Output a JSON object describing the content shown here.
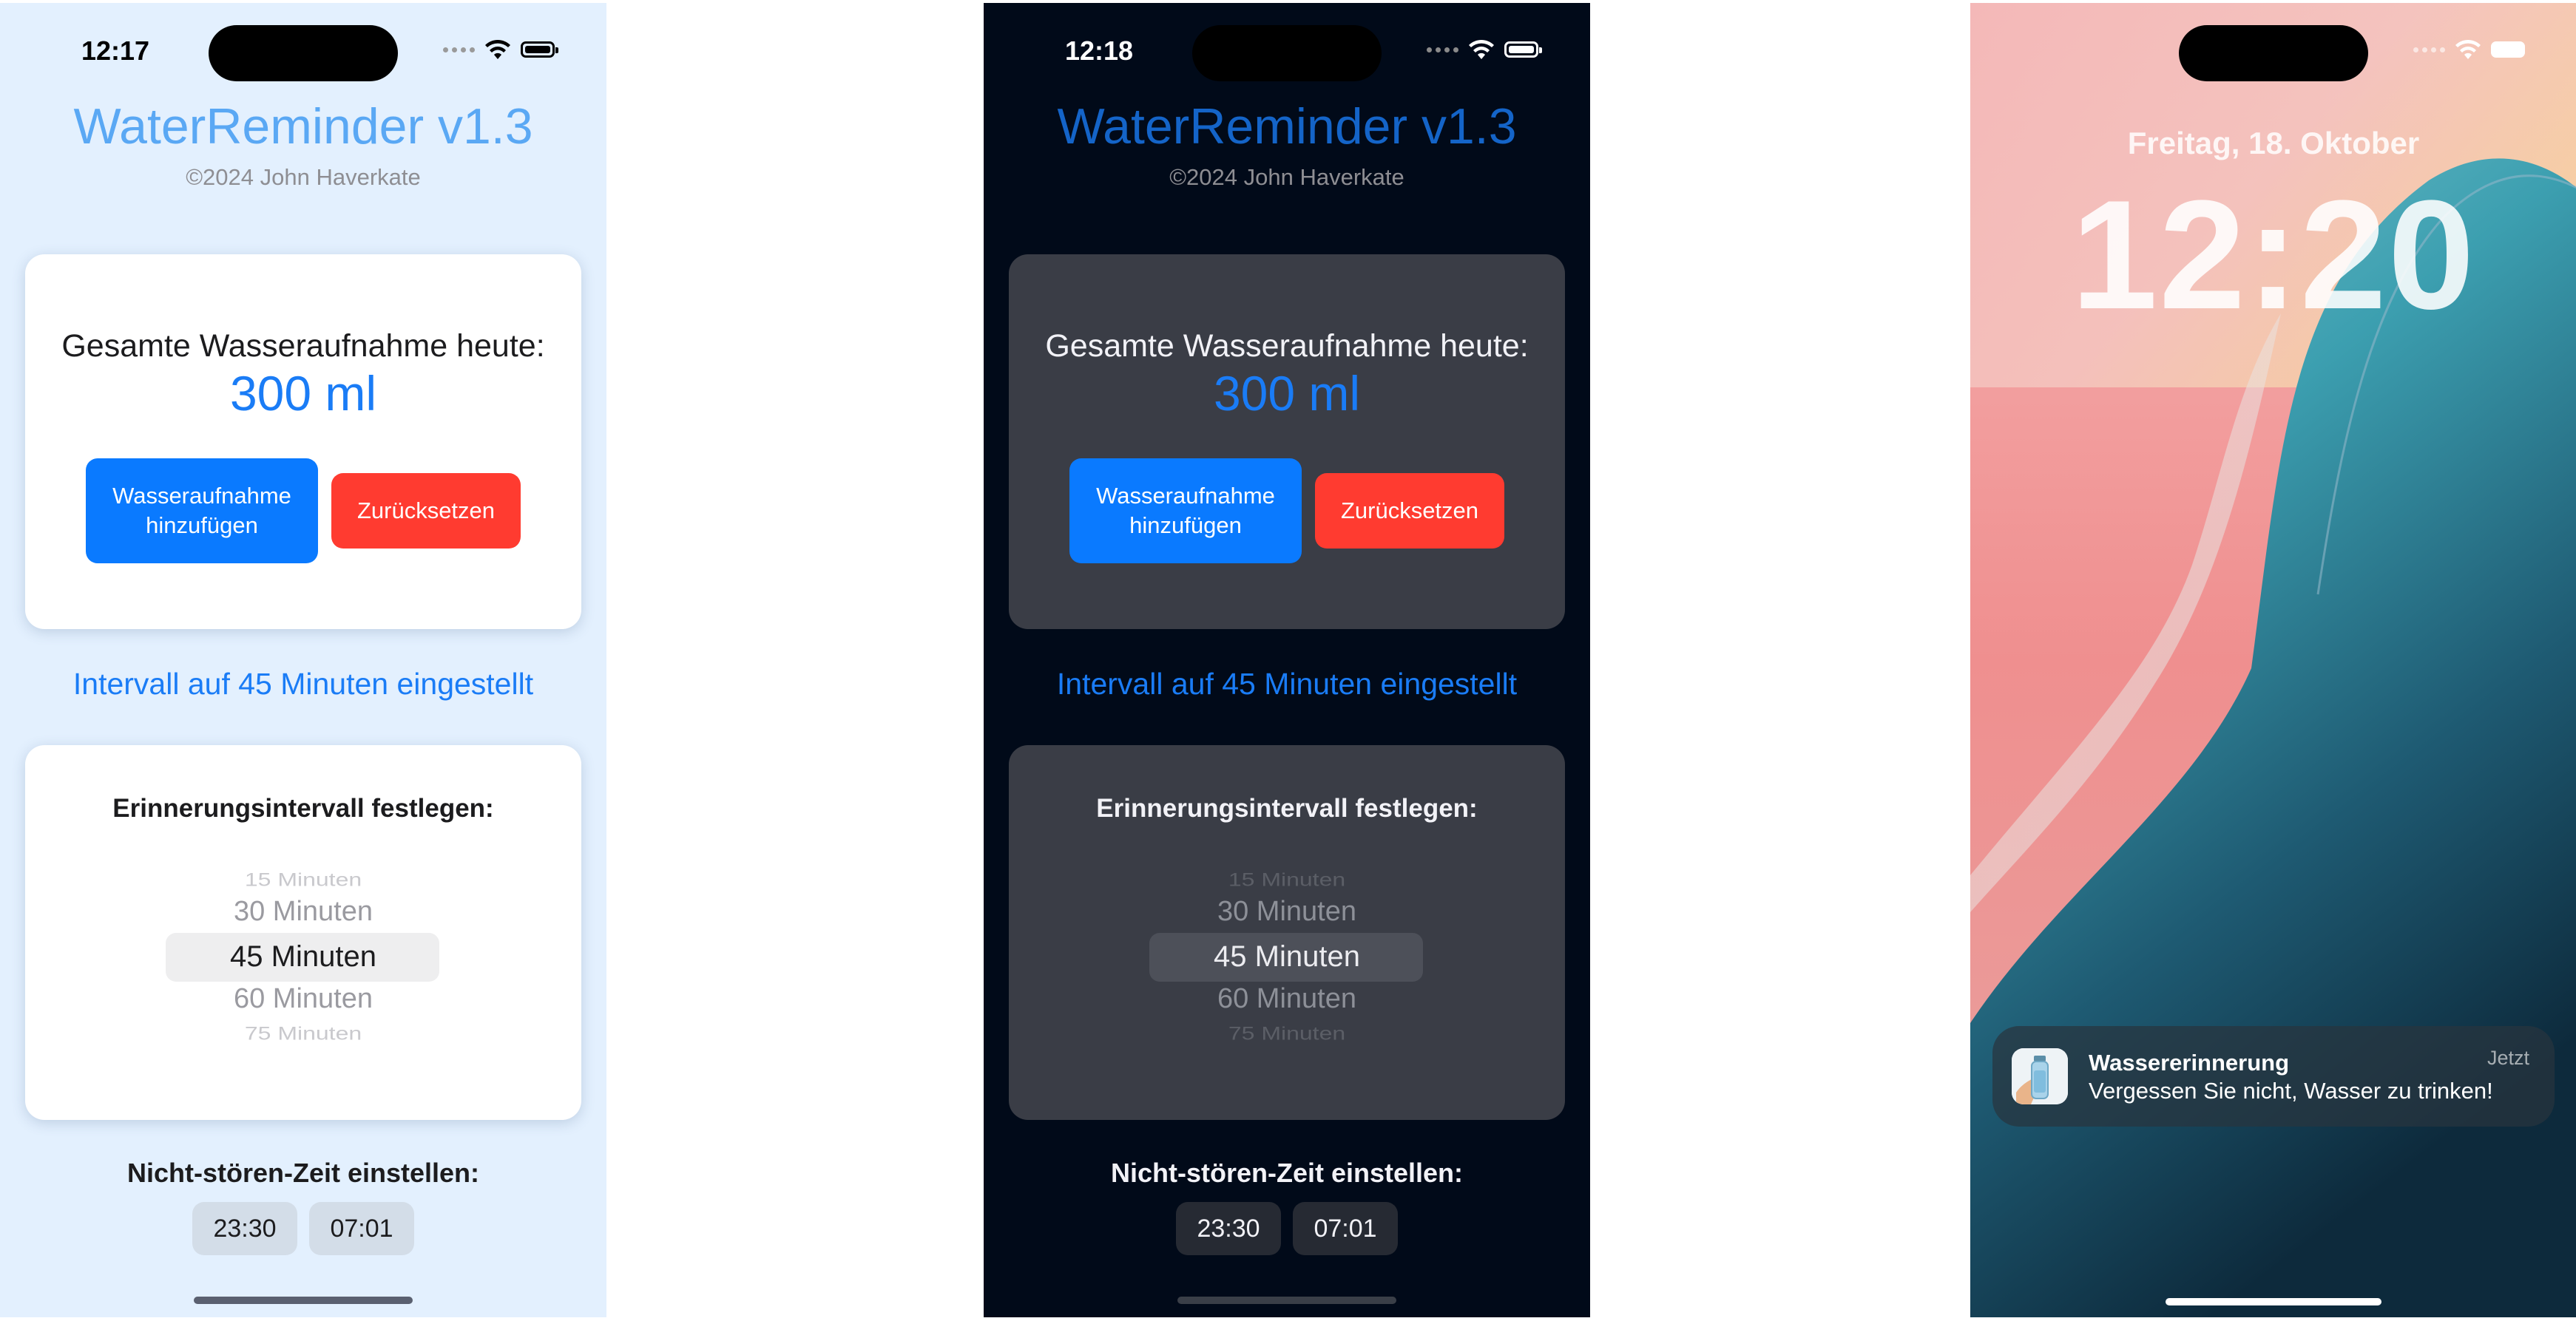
{
  "app": {
    "title": "WaterReminder v1.3",
    "copyright": "©2024 John Haverkate",
    "total_label": "Gesamte Wasseraufnahme heute:",
    "total_value": "300 ml",
    "add_button_line1": "Wasseraufnahme",
    "add_button_line2": "hinzufügen",
    "reset_button": "Zurücksetzen",
    "interval_status": "Intervall auf 45 Minuten eingestellt",
    "picker_title": "Erinnerungsintervall festlegen:",
    "picker_options": [
      "15 Minuten",
      "30 Minuten",
      "45 Minuten",
      "60 Minuten",
      "75 Minuten"
    ],
    "picker_selected": "45 Minuten",
    "dnd_label": "Nicht-stören-Zeit einstellen:",
    "dnd_start": "23:30",
    "dnd_end": "07:01"
  },
  "light_status": {
    "time": "12:17"
  },
  "dark_status": {
    "time": "12:18"
  },
  "lock": {
    "date": "Freitag, 18. Oktober",
    "time": "12:20",
    "notification": {
      "title": "Wassererinnerung",
      "body": "Vergessen Sie nicht, Wasser zu trinken!",
      "time": "Jetzt"
    }
  },
  "colors": {
    "accent_blue": "#1a7cf6",
    "add_button": "#0a7aff",
    "reset_button": "#ff3b30",
    "light_bg": "#e3f0fe",
    "dark_bg": "#010a19"
  }
}
